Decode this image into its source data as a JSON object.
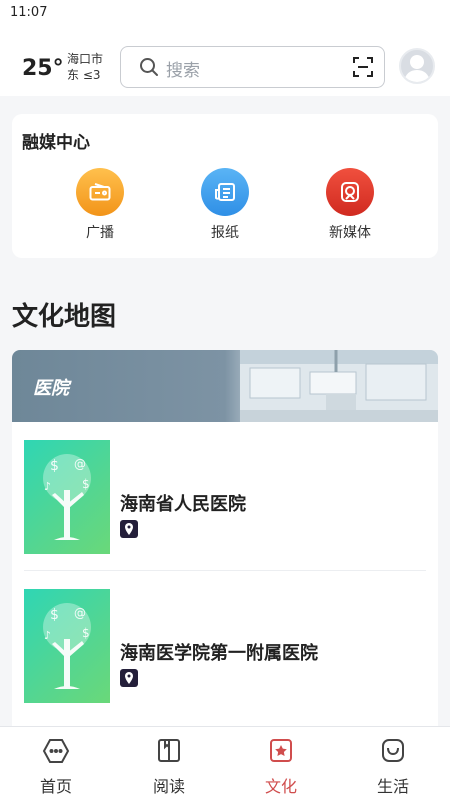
{
  "status_bar": {
    "time": "11:07"
  },
  "weather": {
    "temperature": "25°",
    "city": "海口市",
    "wind": "东 ≤3"
  },
  "search": {
    "placeholder": "搜索",
    "icon": "search-icon",
    "scan_icon": "scan-icon"
  },
  "media_center": {
    "title": "融媒中心",
    "items": [
      {
        "label": "广播",
        "icon": "radio-icon",
        "color": "#f7a230"
      },
      {
        "label": "报纸",
        "icon": "newspaper-icon",
        "color": "#3c9ff0"
      },
      {
        "label": "新媒体",
        "icon": "new-media-icon",
        "color": "#e03b2e"
      }
    ]
  },
  "culture_map": {
    "title": "文化地图",
    "category": "医院",
    "items": [
      {
        "name": "海南省人民医院",
        "icon": "location-pin-icon"
      },
      {
        "name": "海南医学院第一附属医院",
        "icon": "location-pin-icon"
      }
    ]
  },
  "tabbar": {
    "active_color": "#d04d4d",
    "tabs": [
      {
        "label": "首页",
        "icon": "home-icon"
      },
      {
        "label": "阅读",
        "icon": "book-icon"
      },
      {
        "label": "文化",
        "icon": "culture-icon",
        "active": true
      },
      {
        "label": "生活",
        "icon": "life-icon"
      }
    ]
  }
}
